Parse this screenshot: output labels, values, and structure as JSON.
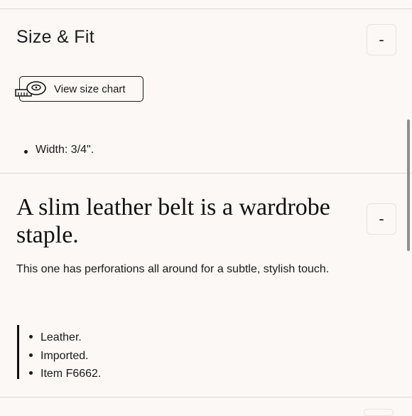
{
  "size_fit": {
    "title": "Size & Fit",
    "collapse_symbol": "-",
    "size_chart_label": "View size chart",
    "size_chart_icon": "tape-measure-icon",
    "details": [
      "Width: 3/4\"."
    ]
  },
  "description": {
    "headline": "A slim leather belt is a wardrobe staple.",
    "collapse_symbol": "-",
    "text": "This one has perforations all around for a subtle, stylish touch.",
    "features": [
      "Leather.",
      "Imported.",
      "Item F6662."
    ]
  },
  "colors": {
    "background": "#fbf8f5",
    "divider": "#d9d6d3",
    "text": "#1a1a1a"
  }
}
